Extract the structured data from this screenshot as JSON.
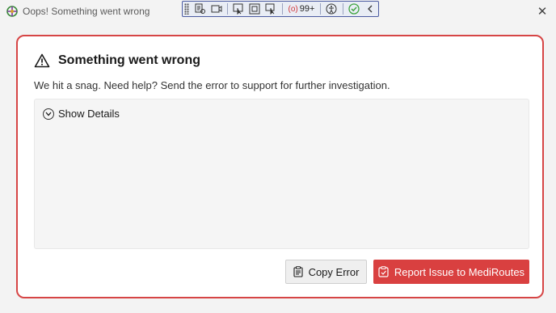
{
  "window": {
    "title": "Oops! Something went wrong",
    "close_glyph": "✕"
  },
  "devtools_bar": {
    "count_label": "99+",
    "icons": [
      "live-visual-tree-icon",
      "record-icon",
      "select-element-icon",
      "display-layout-adorners-icon",
      "track-focus-icon",
      "accessibility-icon",
      "binding-failures-ok-icon",
      "collapse-chevron-icon"
    ]
  },
  "dialog": {
    "heading": "Something went wrong",
    "message": "We hit a snag. Need help? Send the error to support for further investigation.",
    "details_toggle_label": "Show Details",
    "copy_button_label": "Copy Error",
    "report_button_label": "Report Issue to MediRoutes"
  },
  "colors": {
    "accent_red": "#d94040",
    "dialog_border": "#d64545",
    "devbar_border": "#4a5aa0",
    "success_green": "#3fa43f"
  }
}
